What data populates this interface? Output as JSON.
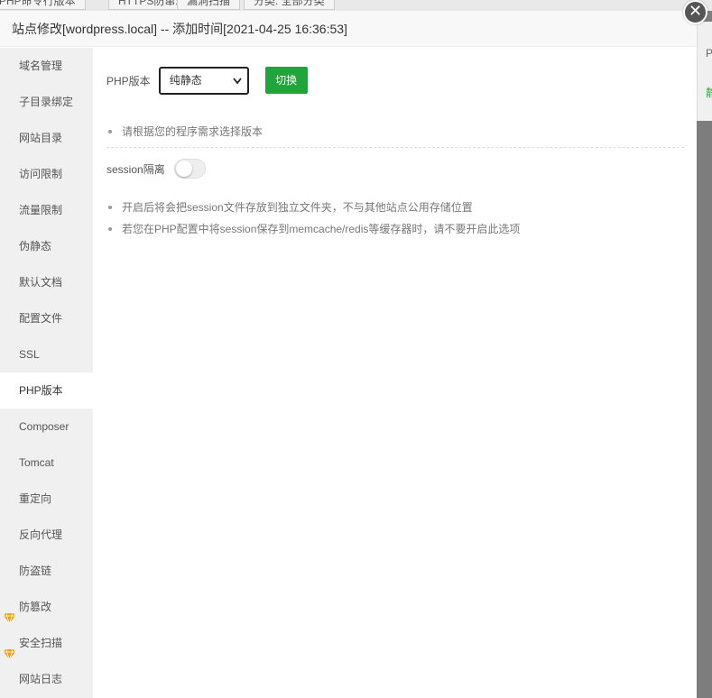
{
  "background": {
    "tabs": [
      "PHP命令行版本",
      "HTTPS防窜站",
      "漏洞扫描",
      "分类: 全部分类"
    ],
    "right_text1": "P",
    "right_text2": "静"
  },
  "modal": {
    "title": "站点修改[wordpress.local] -- 添加时间[2021-04-25 16:36:53]",
    "close_label": "✕"
  },
  "sidebar": {
    "items": [
      {
        "label": "域名管理"
      },
      {
        "label": "子目录绑定"
      },
      {
        "label": "网站目录"
      },
      {
        "label": "访问限制"
      },
      {
        "label": "流量限制"
      },
      {
        "label": "伪静态"
      },
      {
        "label": "默认文档"
      },
      {
        "label": "配置文件"
      },
      {
        "label": "SSL"
      },
      {
        "label": "PHP版本"
      },
      {
        "label": "Composer"
      },
      {
        "label": "Tomcat"
      },
      {
        "label": "重定向"
      },
      {
        "label": "反向代理"
      },
      {
        "label": "防盗链"
      },
      {
        "label": "防篡改"
      },
      {
        "label": "安全扫描"
      },
      {
        "label": "网站日志"
      }
    ],
    "active_index": 9,
    "premium_icon": "gem-icon",
    "premium_color": "#e8a317"
  },
  "php": {
    "label": "PHP版本",
    "selected": "纯静态",
    "switch_label": "切换",
    "tip": "请根据您的程序需求选择版本"
  },
  "session": {
    "label": "session隔离",
    "enabled": false,
    "tips": [
      "开启后将会把session文件存放到独立文件夹，不与其他站点公用存储位置",
      "若您在PHP配置中将session保存到memcache/redis等缓存器时，请不要开启此选项"
    ]
  },
  "colors": {
    "accent": "#20a53a",
    "sidebar_bg": "#f0f0f0",
    "overlay": "#808080"
  }
}
